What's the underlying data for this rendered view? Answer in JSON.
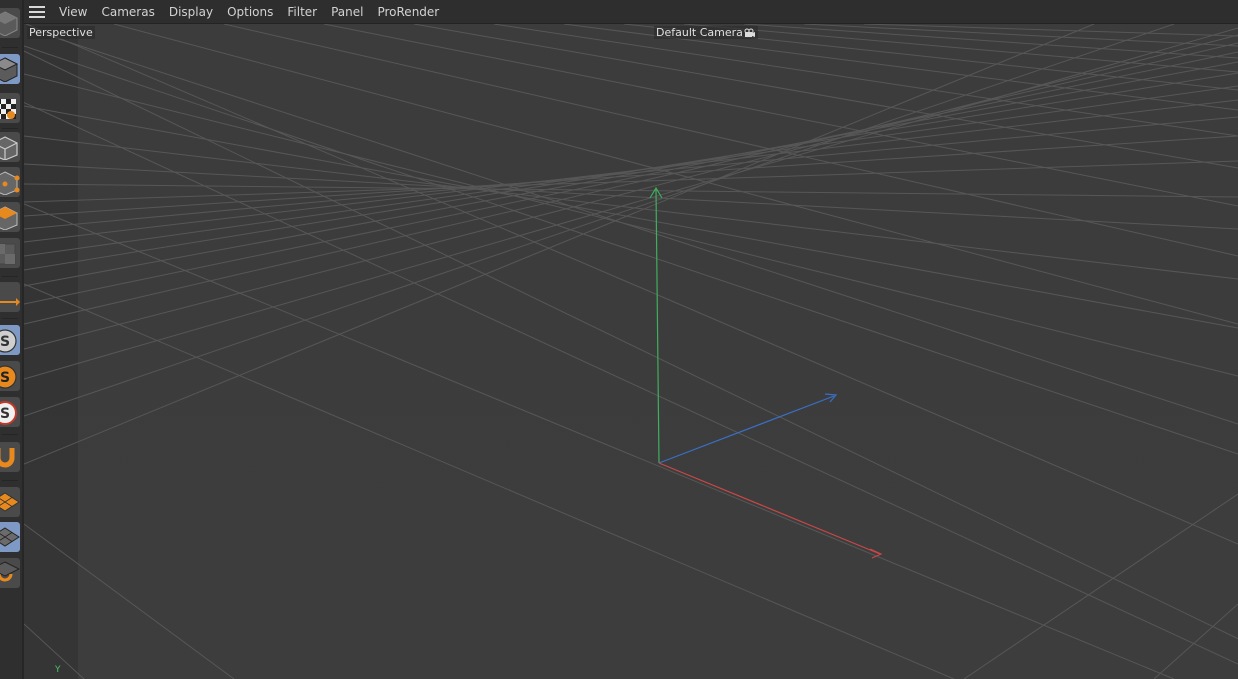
{
  "menubar": {
    "items": [
      "View",
      "Cameras",
      "Display",
      "Options",
      "Filter",
      "Panel",
      "ProRender"
    ]
  },
  "viewport": {
    "projection_label": "Perspective",
    "camera_label": "Default Camera",
    "axis_gizmo_label": "Y"
  },
  "left_toolbar": {
    "tools": [
      "object-cube-icon",
      "cube-mode-icon",
      "checker-texture-icon",
      "model-edit-icon",
      "points-mode-icon",
      "polygons-mode-icon",
      "uv-mode-icon",
      "axis-move-icon",
      "snap-icon",
      "snap-settings-icon",
      "snap-active-icon",
      "magnet-icon",
      "workplane-icon",
      "workplane-grid-icon",
      "lock-workplane-icon"
    ]
  },
  "colors": {
    "axis_x": "#c94747",
    "axis_y": "#3fae5e",
    "axis_z": "#3a6fc4",
    "active_tool": "#7f99c5",
    "accent_orange": "#e8891e"
  }
}
